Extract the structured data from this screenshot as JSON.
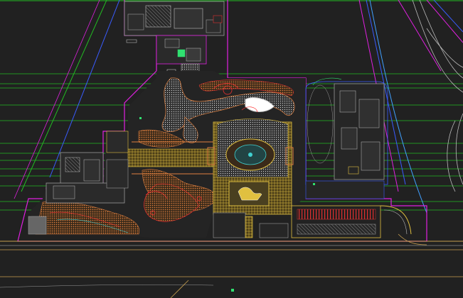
{
  "canvas": {
    "background": "#212121",
    "colors": {
      "grid_line": "#22bb22",
      "boundary_magenta": "#e020e0",
      "boundary_blue": "#3a5cff",
      "contour_cyan": "#40d0d0",
      "plaza_yellow": "#e0c040",
      "hatch_orange": "#e08040",
      "feature_red": "#ff3030",
      "building_gray": "#9a9a9a",
      "road_edge": "#c8a050",
      "accent_green": "#30e070"
    }
  },
  "drawing_elements": {
    "north_building_block": "north-building-block",
    "east_building_block": "east-building-block",
    "west_building_block": "west-building-block",
    "central_plaza": "central-plaza",
    "plaza_oval_feature": "plaza-oval-feature",
    "sculpture_pad": "sculpture-pad",
    "winding_paths": "winding-paths",
    "south_parking_strip": "south-parking-strip",
    "road_edges": "road-edges",
    "site_boundary": "site-boundary"
  }
}
